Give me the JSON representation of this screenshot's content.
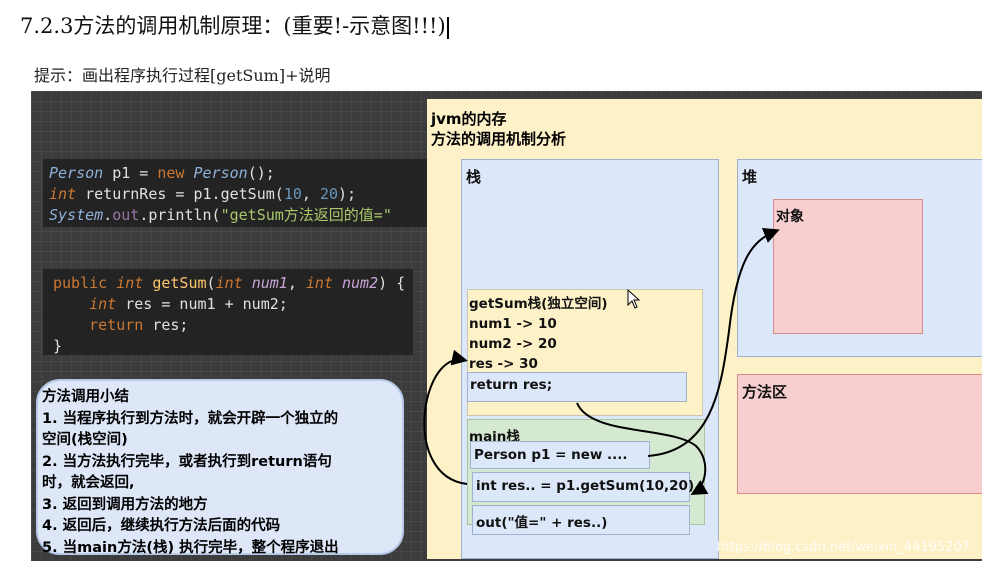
{
  "heading": "7.2.3方法的调用机制原理：(重要!-示意图!!!)",
  "hint": "提示：画出程序执行过程[getSum]+说明",
  "code_snippet_1": {
    "line1": {
      "type": "Person",
      "var": " p1 = ",
      "kw": "new",
      "ctor": "Person",
      "end": "();"
    },
    "line2": {
      "type": "int",
      "rest1": " returnRes = p1.getSum(",
      "n1": "10",
      "comma": ", ",
      "n2": "20",
      "end": ");"
    },
    "line3": {
      "cls": "System",
      "dot1": ".",
      "field": "out",
      "dot2": ".println(",
      "str": "\"getSum方法返回的值=\""
    }
  },
  "code_snippet_2": {
    "line1": {
      "kw": "public",
      "type": "int",
      "name": "getSum",
      "p1type": "int",
      "p1": "num1",
      "p2type": "int",
      "p2": "num2",
      "end": ") {"
    },
    "line2": {
      "type": "int",
      "rest": " res = num1 + num2;"
    },
    "line3": {
      "kw": "return",
      "rest": " res;"
    },
    "line4": "}"
  },
  "summary": {
    "title": "方法调用小结",
    "items": [
      "1. 当程序执行到方法时，就会开辟一个独立的",
      "空间(栈空间)",
      "2. 当方法执行完毕，或者执行到return语句",
      "时，就会返回,",
      "3. 返回到调用方法的地方",
      "4. 返回后，继续执行方法后面的代码",
      "5. 当main方法(栈) 执行完毕，整个程序退出"
    ]
  },
  "jvm": {
    "title_line1": "jvm的内存",
    "title_line2": "方法的调用机制分析",
    "stack_label": "栈",
    "heap_label": "堆",
    "object_label": "对象",
    "method_area_label": "方法区",
    "getsum_frame": {
      "title": "getSum栈(独立空间)",
      "lines": [
        "num1 -> 10",
        "num2 -> 20",
        "res -> 30"
      ],
      "return_line": "return res;"
    },
    "main_frame": {
      "title": "main栈",
      "lines": [
        "Person p1 = new ....",
        "int res.. = p1.getSum(10,20)",
        "out(\"值=\" + res..)"
      ]
    }
  },
  "watermark": "https://blog.csdn.net/weixin_44195207",
  "colors": {
    "stack": "#dce8f9",
    "heap_object": "#f7cfcf",
    "jvm_bg": "#fdf1c8",
    "main_frame": "#d5e8d0",
    "slide_bg": "#3c3c3c"
  }
}
